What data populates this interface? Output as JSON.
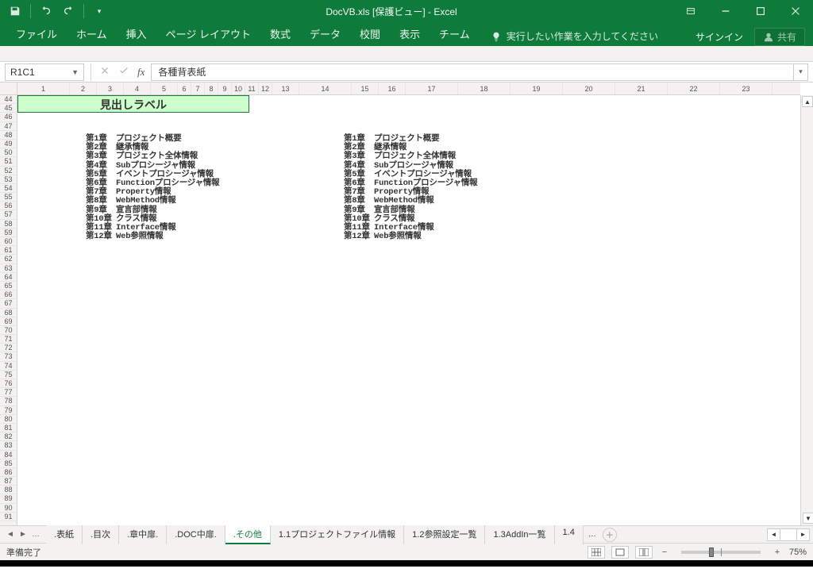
{
  "title": "DocVB.xls  [保護ビュー] - Excel",
  "ribbon": [
    "ファイル",
    "ホーム",
    "挿入",
    "ページ レイアウト",
    "数式",
    "データ",
    "校閲",
    "表示",
    "チーム"
  ],
  "tellme": "実行したい作業を入力してください",
  "signin": "サインイン",
  "share": "共有",
  "namebox": "R1C1",
  "formula": "各種背表紙",
  "rowStart": 44,
  "rowEnd": 91,
  "cols": [
    1,
    2,
    3,
    4,
    5,
    6,
    7,
    8,
    9,
    10,
    11,
    12,
    13,
    14,
    15,
    16,
    17,
    18,
    19,
    20,
    21,
    22,
    23
  ],
  "selCell": "見出しラベル",
  "chapters": [
    {
      "ch": "第1章",
      "t": "プロジェクト概要"
    },
    {
      "ch": "第2章",
      "t": "継承情報"
    },
    {
      "ch": "第3章",
      "t": "プロジェクト全体情報"
    },
    {
      "ch": "第4章",
      "t": "Subプロシージャ情報"
    },
    {
      "ch": "第5章",
      "t": "イベントプロシージャ情報"
    },
    {
      "ch": "第6章",
      "t": "Functionプロシージャ情報"
    },
    {
      "ch": "第7章",
      "t": "Property情報"
    },
    {
      "ch": "第8章",
      "t": "WebMethod情報"
    },
    {
      "ch": "第9章",
      "t": "宣言部情報"
    },
    {
      "ch": "第10章",
      "t": "クラス情報"
    },
    {
      "ch": "第11章",
      "t": "Interface情報"
    },
    {
      "ch": "第12章",
      "t": "Web参照情報"
    }
  ],
  "tabs": [
    ".表紙",
    ".目次",
    ".章中扉.",
    ".DOC中扉.",
    ".その他",
    "1.1プロジェクトファイル情報",
    "1.2参照設定一覧",
    "1.3AddIn一覧",
    "1.4"
  ],
  "activeTab": 4,
  "status": "準備完了",
  "zoom": "75%"
}
